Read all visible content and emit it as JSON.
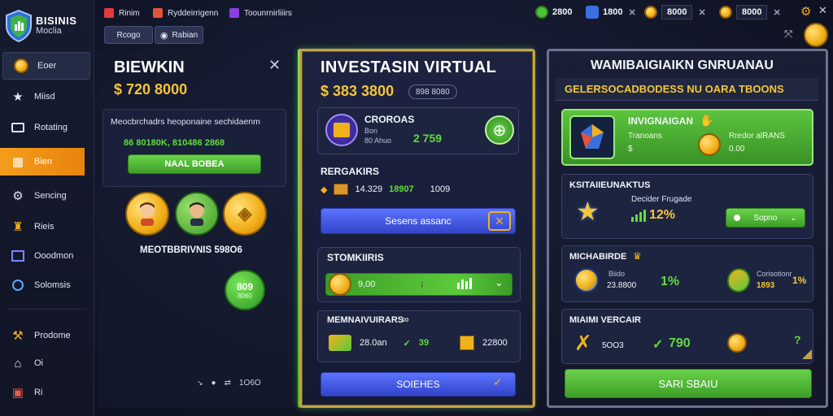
{
  "sidebar": {
    "logo_line1": "BISINIS",
    "logo_line2": "Moclia",
    "items": [
      {
        "label": "Eoer",
        "icon": "coin-icon"
      },
      {
        "label": "Miisd",
        "icon": "star-icon"
      },
      {
        "label": "Rotating",
        "icon": "wallet-icon"
      },
      {
        "label": "Bien",
        "icon": "shop-icon",
        "active": true
      },
      {
        "label": "Sencing",
        "icon": "gear-icon"
      },
      {
        "label": "Rieis",
        "icon": "building-icon"
      },
      {
        "label": "Ooodmon",
        "icon": "chart-icon"
      },
      {
        "label": "Solomsis",
        "icon": "globe-icon"
      },
      {
        "label": "Prodome",
        "icon": "tools-icon"
      },
      {
        "label": "Oi",
        "icon": "home-icon"
      },
      {
        "label": "Ri",
        "icon": "box-icon"
      }
    ]
  },
  "topbar": {
    "links": [
      {
        "label": "Rinim",
        "color": "#e23b3b"
      },
      {
        "label": "Ryddeirrigenn",
        "color": "#e2533b"
      },
      {
        "label": "Toounrnirliiirs",
        "color": "#8a3de0"
      }
    ],
    "tabs": [
      {
        "label": "Rcogo"
      },
      {
        "label": "Rabian"
      }
    ],
    "resources": [
      {
        "value": "2800",
        "color": "#4fc03a"
      },
      {
        "value": "1800",
        "color": "#3b6fe0"
      },
      {
        "value": "8000",
        "color": "#f0b21c"
      },
      {
        "value": "8000",
        "color": "#f0b21c"
      }
    ]
  },
  "panel_left": {
    "title": "BIEWKIN",
    "balance": "$ 720 8000",
    "subtitle": "Meocbrchadrs heoponaine sechidaenm",
    "green_row": "86 80180K, 810486 2868",
    "button": "NAAL BOBEA",
    "caption": "MEOTBBRIVNIS 598O6",
    "badge_line1": "809",
    "badge_line2": "8060",
    "footer": "1O6O"
  },
  "panel_mid": {
    "title": "INVESTASIN VIRTUAL",
    "balance": "$ 383 3800",
    "chip": "898 8080",
    "card1_title": "CROROAS",
    "card1_sub1": "Bon",
    "card1_sub2": "80 Ahuo",
    "card1_value": "2 759",
    "sec_title": "RERGAKIRS",
    "sec_v1": "14.329",
    "sec_v2": "18907",
    "sec_v3": "1009",
    "blue_button": "Sesens assanc",
    "card2_title": "STOMKIIRIS",
    "card2_value": "9,00",
    "card3_title": "MEMNAIVUIRARS",
    "card3_v1": "28.0an",
    "card3_v2": "39",
    "card3_v3": "22800",
    "bottom_button": "SOIEHES"
  },
  "panel_right": {
    "title": "WAMIBAIGIAIKN GNRUANAU",
    "subtitle": "GELERSOCADBODESS NU OARA TBOONS",
    "card1_title": "INVIGNAIGAN",
    "card1_l1": "Tranoans",
    "card1_l2": "$",
    "card1_r1": "Rredor alRANS",
    "card1_r2": "0.00",
    "card2_title": "KSITAIIEUNAKTUS",
    "card2_l1": "Decider Frugade",
    "card2_pct": "12%",
    "card2_btn": "Sopno",
    "card3_title": "MICHABIRDE",
    "card3_l1": "Biido",
    "card3_v1": "23.8800",
    "card3_pct": "1%",
    "card3_r1": "Corisotionr",
    "card3_v2": "1893",
    "card3_v3": "1%",
    "card4_title": "MIAIMI VERCAIR",
    "card4_v1": "5OO3",
    "card4_v2": "790",
    "card4_q": "?",
    "bottom_button": "SARI SBAIU"
  }
}
